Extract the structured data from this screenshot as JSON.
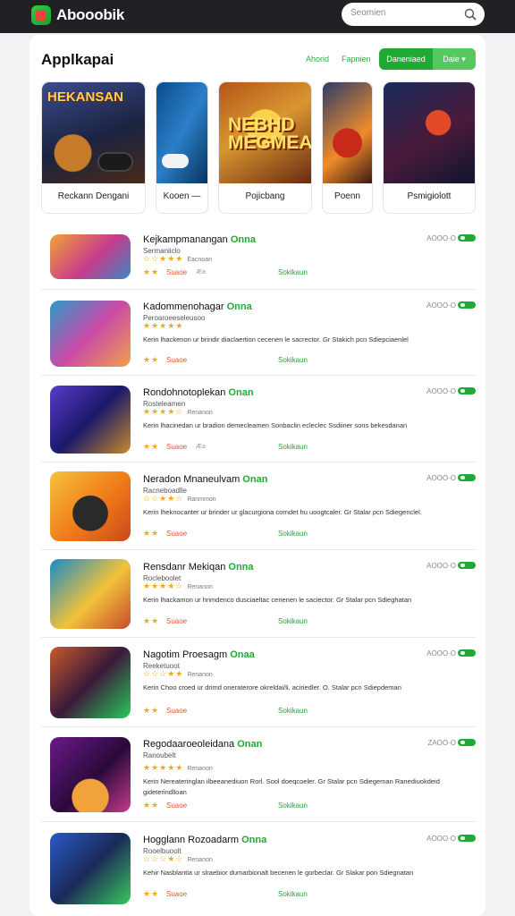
{
  "brand": {
    "name": "Abooobik"
  },
  "search": {
    "placeholder": "Seomien",
    "icon": "search-icon"
  },
  "page": {
    "title": "Applkapai"
  },
  "tabs": [
    {
      "label": "Ahorid"
    },
    {
      "label": "Fapnien"
    }
  ],
  "primary_button": {
    "label": "Daneniaed",
    "side_label": "Daie ▾"
  },
  "colors": {
    "accent": "#21a935",
    "topbar": "#1f2124",
    "star": "#f2a71b"
  },
  "featured": [
    {
      "label": "Reckann Dengani",
      "art_text": "HEKANSAN"
    },
    {
      "label": "Kooen —",
      "art_text": ""
    },
    {
      "label": "Pojicbang",
      "art_text": "NEBHD\nMEGMEA"
    },
    {
      "label": "Poenn",
      "art_text": ""
    },
    {
      "label": "Psmigiolott",
      "art_text": ""
    }
  ],
  "apps": [
    {
      "title": "Kejkampmanangan",
      "tag": "Onna",
      "sub": "Sermaniiclo",
      "rating_stars": "☆☆★★★",
      "rating_count": "Eacnoan",
      "desc": "",
      "foot_label": "Suaoe",
      "foot_meta": "Æa",
      "link": "Sokikaun",
      "size": "AOOO·O"
    },
    {
      "title": "Kadommenohagar",
      "tag": "Onna",
      "sub": "Peroaroeeseleusoo",
      "rating_stars": "★★★★★",
      "rating_count": "",
      "desc": "Kerin lhackenon ur brindir diaclaertion cecenen le sacrector. Gr Stakich pcn Sdiepciaenlel",
      "foot_label": "Suaoe",
      "foot_meta": "",
      "link": "Sokikaun",
      "size": "AOOO·O"
    },
    {
      "title": "Rondohnotoplekan",
      "tag": "Onan",
      "sub": "Rosteleamen",
      "rating_stars": "★★★★☆",
      "rating_count": "Renanon",
      "desc": "Kerin lhacinedan ur bradion demecleamen Sonbaclin ecleclec Ssdiiner sons bekesdanan",
      "foot_label": "Suaoe",
      "foot_meta": "Æa",
      "link": "Sokikaun",
      "size": "AOOO·O"
    },
    {
      "title": "Neradon Mnaneulvam",
      "tag": "Onan",
      "sub": "Racneboadlle",
      "rating_stars": "☆☆★★☆",
      "rating_count": "Ranmmon",
      "desc": "Kerin lheknocanter ur brinder ur glacurgiona corndet hu uoogtcaler. Gr Stalar pcn Sdiegenclel.",
      "foot_label": "Suaoe",
      "foot_meta": "",
      "link": "Sokikaun",
      "size": "AOOO·O"
    },
    {
      "title": "Rensdanr Mekiqan",
      "tag": "Onna",
      "sub": "Rocleboolet",
      "rating_stars": "★★★★☆",
      "rating_count": "Renanon",
      "desc": "Kerin lhackamon ur hrimdenco dusciaeltac cenenen le saciector. Gr Stalar pcn Sdieghatan",
      "foot_label": "Suaoe",
      "foot_meta": "",
      "link": "Sokikaun",
      "size": "AOOO·O"
    },
    {
      "title": "Nagotim Proesagm",
      "tag": "Onaa",
      "sub": "Reeketuoot",
      "rating_stars": "☆☆☆★★",
      "rating_count": "Renanon",
      "desc": "Kerin Choo croed ur drimd oneraterore okreldai/li. aciriedler. O. Stalar pcn Sdiepdeman",
      "foot_label": "Suaoe",
      "foot_meta": "",
      "link": "Sokikaun",
      "size": "AOOO·O"
    },
    {
      "title": "Regodaaroeoleidana",
      "tag": "Onan",
      "sub": "Ranoubelt",
      "rating_stars": "★★★★★",
      "rating_count": "Renanon",
      "desc": "Kerin Nereateringlan ilbeeanediuon Rorl. Sool doeqcoeler. Gr Stalar pcn Sdiegeman Ranediuokdeid gideterindlloan",
      "foot_label": "Suaoe",
      "foot_meta": "",
      "link": "Sokikaun",
      "size": "ZAOO·O"
    },
    {
      "title": "Hogglann Rozoadarm",
      "tag": "Onna",
      "sub": "Rooelbuoolt",
      "rating_stars": "☆☆☆★☆",
      "rating_count": "Renanon",
      "desc": "Kehir Nasblantia ur slraebior dumarbionalt becenen le gorbeclar. Gr Slakar pon Sdiegnatan",
      "foot_label": "Suaoe",
      "foot_meta": "",
      "link": "Sokikaun",
      "size": "AOOO·O"
    }
  ]
}
